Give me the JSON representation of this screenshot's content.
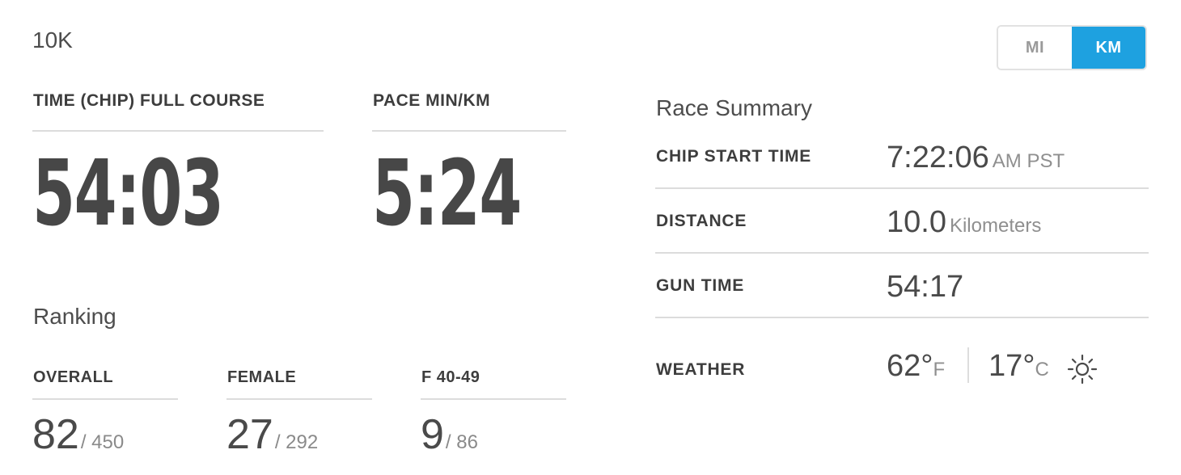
{
  "race": {
    "name": "10K"
  },
  "time": {
    "label": "TIME (CHIP) FULL COURSE",
    "value": "54:03"
  },
  "pace": {
    "label": "PACE MIN/KM",
    "value": "5:24"
  },
  "ranking": {
    "title": "Ranking",
    "items": [
      {
        "label": "OVERALL",
        "place": "82",
        "total": "/ 450"
      },
      {
        "label": "FEMALE",
        "place": "27",
        "total": "/ 292"
      },
      {
        "label": "F 40-49",
        "place": "9",
        "total": "/ 86"
      }
    ]
  },
  "unit_toggle": {
    "options": [
      "MI",
      "KM"
    ],
    "selected": "KM",
    "accent_color": "#1ea1e0"
  },
  "summary": {
    "title": "Race Summary",
    "chip_start": {
      "label": "CHIP START TIME",
      "value": "7:22:06",
      "unit": "AM PST"
    },
    "distance": {
      "label": "DISTANCE",
      "value": "10.0",
      "unit": "Kilometers"
    },
    "gun_time": {
      "label": "GUN TIME",
      "value": "54:17"
    },
    "weather": {
      "label": "WEATHER",
      "temp_f": "62°",
      "unit_f": "F",
      "temp_c": "17°",
      "unit_c": "C",
      "icon": "sun-icon"
    }
  }
}
